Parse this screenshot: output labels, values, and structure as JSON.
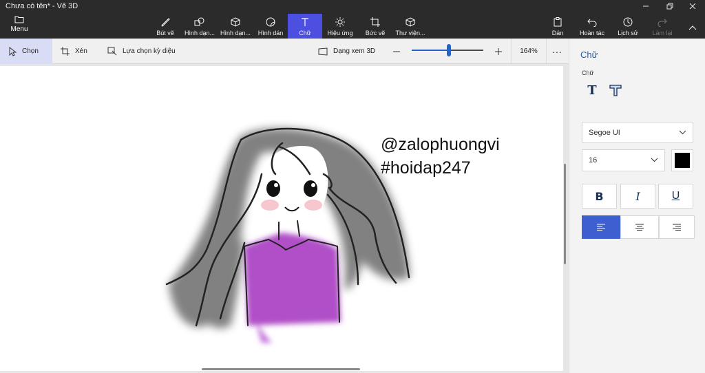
{
  "window": {
    "title": "Chưa có tên* - Vẽ 3D"
  },
  "ribbon": {
    "menu_label": "Menu",
    "tools": [
      {
        "label": "Bút vẽ",
        "icon": "brush-icon"
      },
      {
        "label": "Hình dạn...",
        "icon": "2d-shapes-icon"
      },
      {
        "label": "Hình dạn...",
        "icon": "3d-shapes-icon"
      },
      {
        "label": "Hình dán",
        "icon": "stickers-icon"
      },
      {
        "label": "Chữ",
        "icon": "text-icon",
        "active": true
      },
      {
        "label": "Hiệu ứng",
        "icon": "effects-icon"
      },
      {
        "label": "Bức vẽ",
        "icon": "canvas-icon"
      },
      {
        "label": "Thư viện...",
        "icon": "3d-library-icon"
      }
    ],
    "right_tools": [
      {
        "label": "Dán",
        "icon": "paste-icon"
      },
      {
        "label": "Hoàn tác",
        "icon": "undo-icon"
      },
      {
        "label": "Lịch sử",
        "icon": "history-icon"
      },
      {
        "label": "Làm lại",
        "icon": "redo-icon",
        "disabled": true
      }
    ]
  },
  "toolbar": {
    "select_label": "Chọn",
    "crop_label": "Xén",
    "magic_select_label": "Lựa chọn kỳ diệu",
    "view3d_label": "Dạng xem 3D",
    "zoom_level": "164%",
    "zoom_fraction": 0.52
  },
  "canvas": {
    "text_lines": [
      "@zalophuongvi",
      "#hoidap247"
    ]
  },
  "panel": {
    "title": "Chữ",
    "section_label": "Chữ",
    "font_family": "Segoe UI",
    "font_size": "16",
    "text_color": "#000000",
    "bold_label": "B",
    "italic_label": "I",
    "underline_label": "U",
    "alignment": "left"
  },
  "colors": {
    "accent": "#4c4fe0",
    "hair": "#6c6c6c",
    "shirt": "#b050c8"
  }
}
